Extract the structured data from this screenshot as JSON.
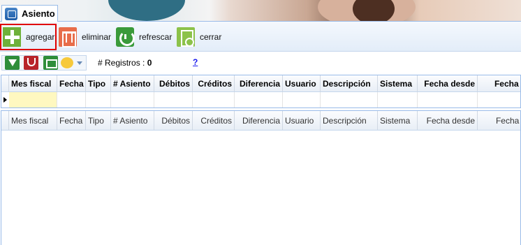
{
  "tab": {
    "title": "Asiento"
  },
  "toolbar": {
    "add_label": "agregar",
    "delete_label": "eliminar",
    "refresh_label": "refrescar",
    "close_label": "cerrar"
  },
  "subtoolbar": {
    "records_label": "# Registros :",
    "records_count": "0",
    "help_label": "?"
  },
  "grid": {
    "columns": [
      "Mes fiscal",
      "Fecha",
      "Tipo",
      "# Asiento",
      "Débitos",
      "Créditos",
      "Diferencia",
      "Usuario",
      "Descripción",
      "Sistema",
      "Fecha desde",
      "Fecha ha"
    ]
  },
  "colors": {
    "highlight": "#e00000",
    "editing_cell": "#fff8c0",
    "border": "#99bbe8"
  }
}
